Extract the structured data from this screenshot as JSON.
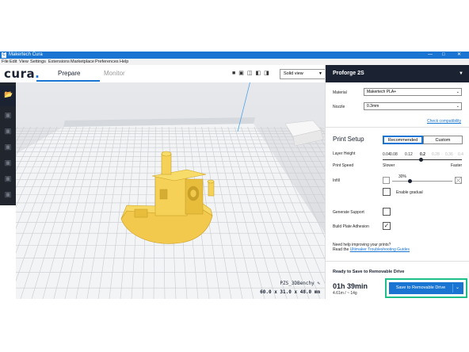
{
  "window": {
    "title": "Makertech Cura",
    "controls": [
      "—",
      "□",
      "✕"
    ]
  },
  "menu": [
    "File",
    "Edit",
    "View",
    "Settings",
    "Extensions",
    "Marketplace",
    "Preferences",
    "Help"
  ],
  "header": {
    "logo_text": "cura",
    "logo_dot": ".",
    "tabs": [
      {
        "label": "Prepare",
        "active": true
      },
      {
        "label": "Monitor",
        "active": false
      }
    ],
    "view_select": "Solid view"
  },
  "left_toolbar": {
    "tools": [
      "open-file-icon",
      "move-tool-icon",
      "scale-tool-icon",
      "rotate-tool-icon",
      "mirror-tool-icon",
      "per-model-settings-icon",
      "support-blocker-icon"
    ]
  },
  "object_info": {
    "name": "PZS_3DBenchy",
    "dimensions": "60.0 x 31.0 x 48.0 mm"
  },
  "panel": {
    "printer_name": "Proforge 2S",
    "material_label": "Material",
    "material_value": "Makertech PLA+",
    "nozzle_label": "Nozzle",
    "nozzle_value": "0.3mm",
    "check_compat": "Check compatibility",
    "print_setup": "Print Setup",
    "mode_recommended": "Recommended",
    "mode_custom": "Custom",
    "layer_height_label": "Layer Height",
    "layer_heights": [
      "0.04",
      "0.08",
      "0.12",
      "0.2",
      "0.28",
      "0.36",
      "0.4"
    ],
    "layer_height_selected": "0.2",
    "print_speed_label": "Print Speed",
    "speed_slower": "Slower",
    "speed_faster": "Faster",
    "infill_label": "Infill",
    "infill_percent": "30%",
    "infill_value": 0.3,
    "enable_gradual": "Enable gradual",
    "enable_gradual_checked": false,
    "generate_support": "Generate Support",
    "generate_support_checked": false,
    "build_plate_adhesion": "Build Plate Adhesion",
    "build_plate_adhesion_checked": true,
    "help_line1": "Need help improving your prints?",
    "help_line2_prefix": "Read the ",
    "help_link": "Ultimaker Troubleshooting Guides",
    "ready_title": "Ready to Save to Removable Drive",
    "print_time": "01h 39min",
    "material_usage": "4.61m / ~ 14g",
    "save_button": "Save to Removable Drive"
  },
  "colors": {
    "accent": "#1a75d2",
    "dark": "#1b2232",
    "highlight_box": "#1fbf8a",
    "model": "#f2c94c"
  }
}
